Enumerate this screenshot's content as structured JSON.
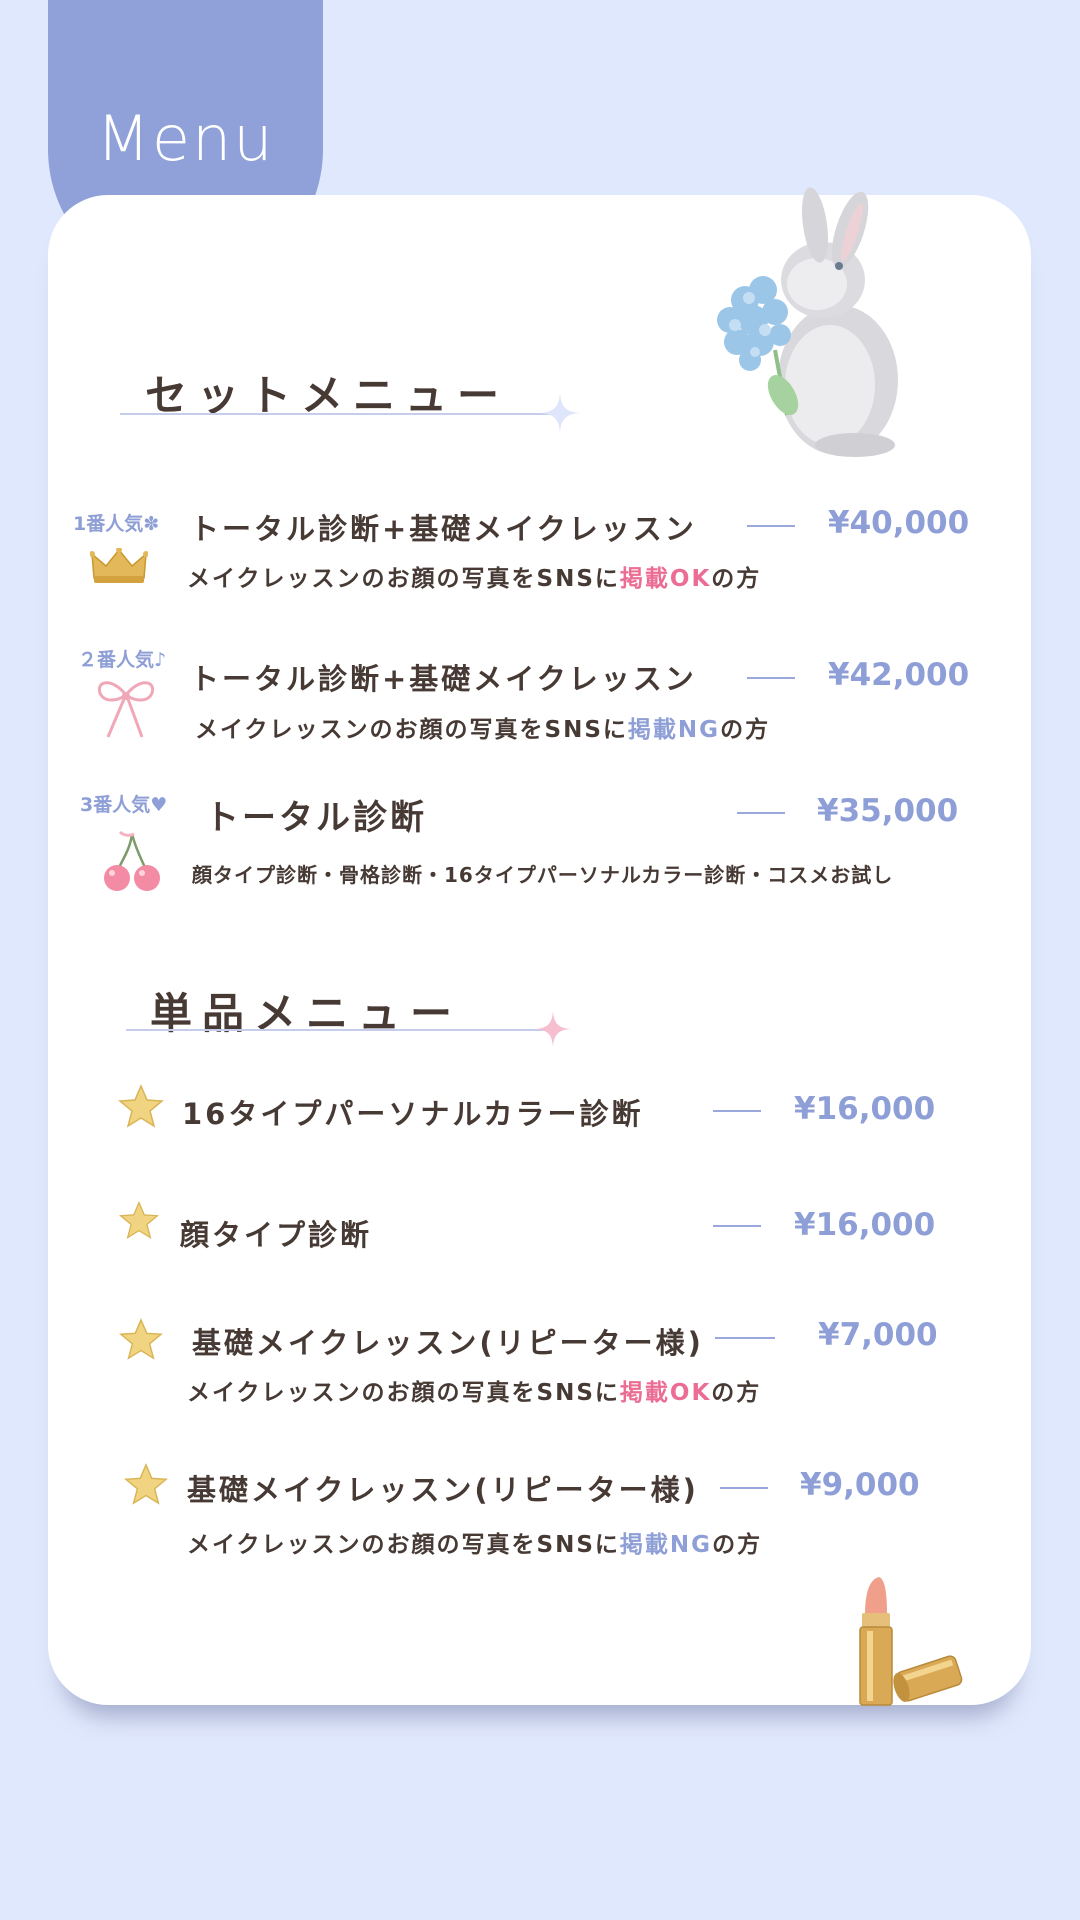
{
  "header": {
    "title": "Menu"
  },
  "colors": {
    "background": "#e0e8fd",
    "tab": "#8fa1d8",
    "price": "#8e9ed6",
    "ok_pink": "#ec6d94",
    "ng_blue": "#8e9ed6",
    "text": "#473a35"
  },
  "set_menu": {
    "title": "セットメニュー",
    "items": [
      {
        "rank": "1番人気✽",
        "rank_icon": "crown-icon",
        "name": "トータル診断+基礎メイクレッスン",
        "price": "¥40,000",
        "desc_before": "メイクレッスンのお顔の写真をSNSに",
        "desc_flag": "掲載OK",
        "desc_after": "の方"
      },
      {
        "rank": "２番人気♪",
        "rank_icon": "ribbon-icon",
        "name": "トータル診断+基礎メイクレッスン",
        "price": "¥42,000",
        "desc_before": "メイクレッスンのお顔の写真をSNSに",
        "desc_flag": "掲載NG",
        "desc_after": "の方"
      },
      {
        "rank": "3番人気♥",
        "rank_icon": "cherry-icon",
        "name": "トータル診断",
        "price": "¥35,000",
        "desc": "顔タイプ診断・骨格診断・16タイプパーソナルカラー診断・コスメお試し"
      }
    ]
  },
  "single_menu": {
    "title": "単品メニュー",
    "items": [
      {
        "name": "16タイプパーソナルカラー診断",
        "price": "¥16,000"
      },
      {
        "name": "顔タイプ診断",
        "price": "¥16,000"
      },
      {
        "name": "基礎メイクレッスン(リピーター様)",
        "price": "¥7,000",
        "desc_before": "メイクレッスンのお顔の写真をSNSに",
        "desc_flag": "掲載OK",
        "desc_after": "の方"
      },
      {
        "name": "基礎メイクレッスン(リピーター様)",
        "price": "¥9,000",
        "desc_before": "メイクレッスンのお顔の写真をSNSに",
        "desc_flag": "掲載NG",
        "desc_after": "の方"
      }
    ]
  },
  "decorations": [
    "rabbit-hydrangea-illustration",
    "lipstick-illustration",
    "star-icon",
    "sparkle-icon"
  ]
}
